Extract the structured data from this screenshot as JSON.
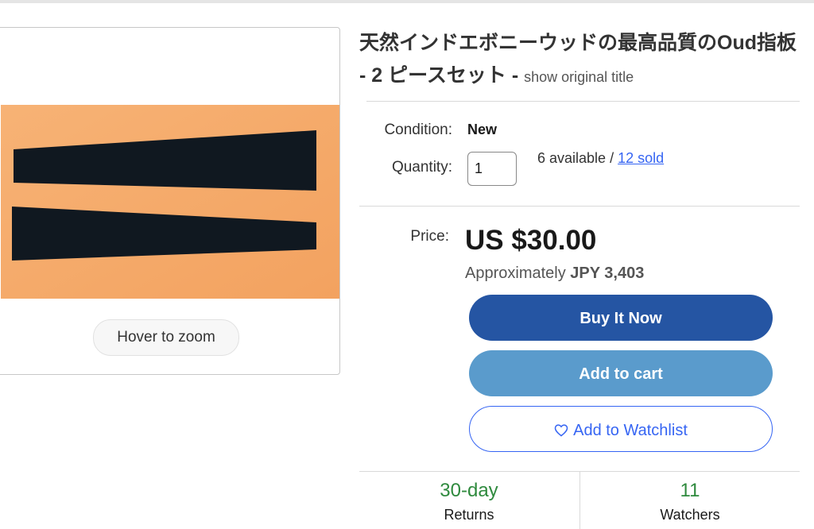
{
  "gallery": {
    "zoom_label": "Hover to zoom"
  },
  "title": {
    "main": "天然インドエボニーウッドの最高品質のOud指板 - 2 ピースセット",
    "separator": "-",
    "show_original": "show original title"
  },
  "condition": {
    "label": "Condition:",
    "value": "New"
  },
  "quantity": {
    "label": "Quantity:",
    "value": "1",
    "available": "6 available /",
    "sold": "12 sold"
  },
  "price": {
    "label": "Price:",
    "amount": "US $30.00",
    "approx_prefix": "Approximately",
    "approx_value": "JPY 3,403"
  },
  "buttons": {
    "buy_now": "Buy It Now",
    "add_to_cart": "Add to cart",
    "watchlist": "Add to Watchlist"
  },
  "stats": {
    "returns_value": "30-day",
    "returns_label": "Returns",
    "watchers_value": "11",
    "watchers_label": "Watchers"
  },
  "colors": {
    "buy_now_bg": "#2555a3",
    "add_to_cart_bg": "#5a9bcc",
    "link_blue": "#3665f3",
    "stat_green": "#2f8a3e",
    "image_bg": "#f5a968"
  },
  "icons": {
    "watchlist": "heart-icon"
  }
}
